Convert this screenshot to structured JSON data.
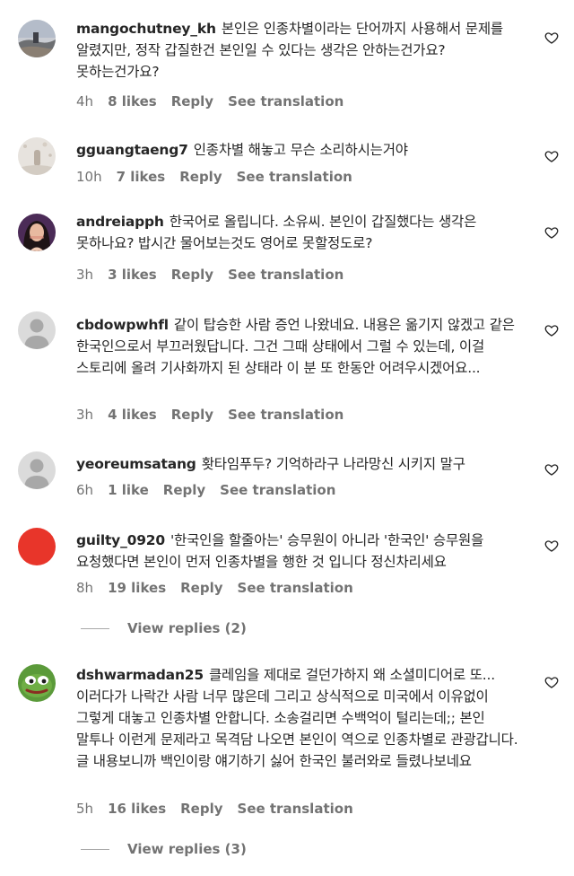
{
  "comments": [
    {
      "username": "mangochutney_kh",
      "text": "본인은 인종차별이라는 단어까지 사용해서 문제를 알렸지만, 정작 갑질한건 본인일 수 있다는 생각은 안하는건가요? 못하는건가요?",
      "time": "4h",
      "likes": "8 likes",
      "reply": "Reply",
      "translate": "See translation",
      "avatar": "landscape-photo"
    },
    {
      "username": "gguangtaeng7",
      "text": "인종차별 해놓고 무슨 소리하시는거야",
      "time": "10h",
      "likes": "7 likes",
      "reply": "Reply",
      "translate": "See translation",
      "avatar": "snowy-photo"
    },
    {
      "username": "andreiapph",
      "text": "한국어로 올립니다. 소유씨. 본인이 갑질했다는 생각은 못하나요? 밥시간 물어보는것도 영어로 못할정도로?",
      "time": "3h",
      "likes": "3 likes",
      "reply": "Reply",
      "translate": "See translation",
      "avatar": "person-photo"
    },
    {
      "username": "cbdowpwhfl",
      "text": "같이 탑승한 사람 증언 나왔네요. 내용은 옮기지 않겠고 같은 한국인으로서 부끄러웠답니다. 그건 그때 상태에서 그럴 수 있는데, 이걸 스토리에 올려 기사화까지 된 상태라 이 분 또 한동안 어려우시겠어요...",
      "time": "3h",
      "likes": "4 likes",
      "reply": "Reply",
      "translate": "See translation",
      "avatar": "default-user"
    },
    {
      "username": "yeoreumsatang",
      "text": "홧타임푸두? 기억하라구 나라망신 시키지 말구",
      "time": "6h",
      "likes": "1 like",
      "reply": "Reply",
      "translate": "See translation",
      "avatar": "default-user"
    },
    {
      "username": "guilty_0920",
      "text": "'한국인을 할줄아는' 승무원이 아니라 '한국인' 승무원을 요청했다면 본인이 먼저 인종차별을 행한 것 입니다 정신차리세요",
      "time": "8h",
      "likes": "19 likes",
      "reply": "Reply",
      "translate": "See translation",
      "avatar": "red-circle",
      "view_replies": "View replies (2)"
    },
    {
      "username": "dshwarmadan25",
      "text_first_line": "클레임을 제대로 걸던가하지 왜 소셜미디어로 또...",
      "text_rest": "이러다가 나락간 사람 너무 많은데 그리고 상식적으로 미국에서 이유없이 그렇게 대놓고 인종차별 안합니다. 소송걸리면 수백억이 털리는데;; 본인 말투나 이런게 문제라고 목격담 나오면 본인이 역으로 인종차별로 관광갑니다. 글 내용보니까 백인이랑 얘기하기 싫어 한국인 불러와로 들렸나보네요",
      "time": "5h",
      "likes": "16 likes",
      "reply": "Reply",
      "translate": "See translation",
      "avatar": "pepe-frog",
      "view_replies": "View replies (3)"
    }
  ],
  "colors": {
    "text": "#262626",
    "secondary": "#737373",
    "red_avatar": "#e8352a",
    "default_avatar_bg": "#dbdbdb",
    "default_avatar_fg": "#a8a8a8"
  }
}
